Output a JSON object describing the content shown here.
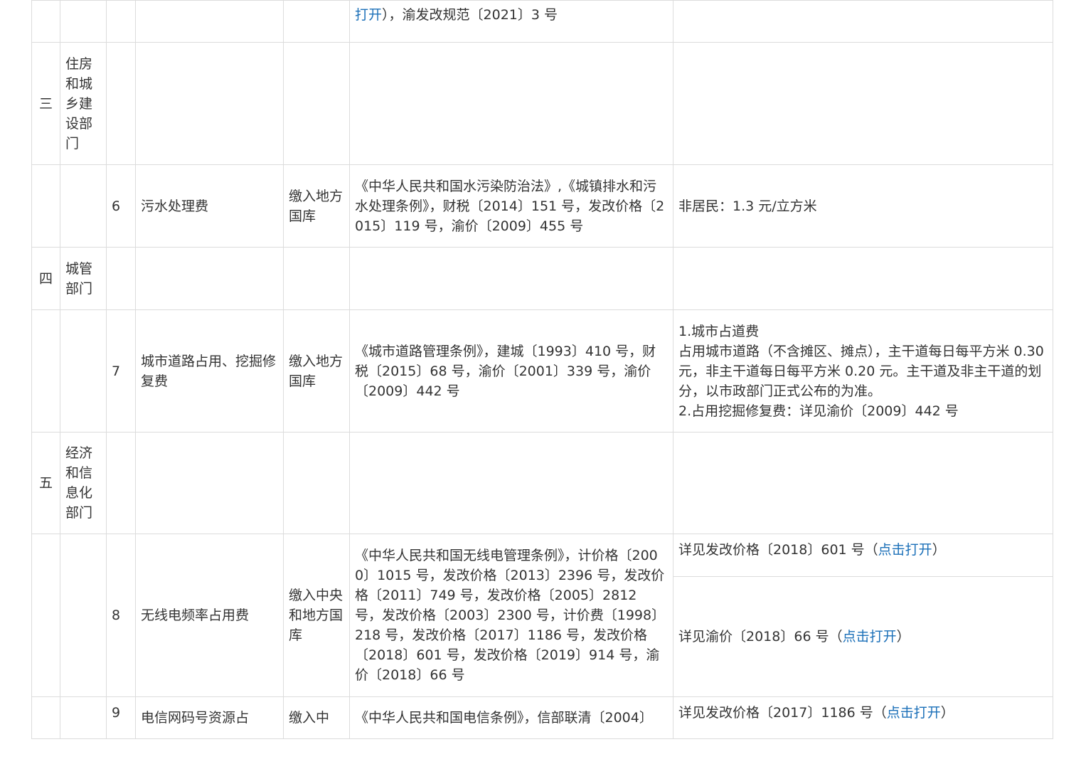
{
  "rows": {
    "row_top": {
      "basis_link": "打开",
      "basis_rest": "），渝发改规范〔2021〕3 号"
    },
    "section_3": {
      "index": "三",
      "dept": "住房和城乡建设部门"
    },
    "item_6": {
      "no": "6",
      "name": "污水处理费",
      "treasury": "缴入地方国库",
      "basis": "《中华人民共和国水污染防治法》,《城镇排水和污水处理条例》，财税〔2014〕151 号，发改价格〔2015〕119 号，渝价〔2009〕455 号",
      "standard": "非居民：1.3 元/立方米"
    },
    "section_4": {
      "index": "四",
      "dept": "城管部门"
    },
    "item_7": {
      "no": "7",
      "name": "城市道路占用、挖掘修复费",
      "treasury": "缴入地方国库",
      "basis": "《城市道路管理条例》，建城〔1993〕410 号，财税〔2015〕68 号，渝价〔2001〕339 号，渝价〔2009〕442 号",
      "standard_line1": "1.城市占道费",
      "standard_line2": "占用城市道路（不含摊区、摊点），主干道每日每平方米 0.30 元，非主干道每日每平方米 0.20 元。主干道及非主干道的划分，以市政部门正式公布的为准。",
      "standard_line3": "2.占用挖掘修复费：详见渝价〔2009〕442 号"
    },
    "section_5": {
      "index": "五",
      "dept": "经济和信息化部门"
    },
    "item_8": {
      "no": "8",
      "name": "无线电频率占用费",
      "treasury": "缴入中央和地方国库",
      "basis": "《中华人民共和国无线电管理条例》，计价格〔2000〕1015 号，发改价格〔2013〕2396 号，发改价格〔2011〕749 号，发改价格〔2005〕2812 号，发改价格〔2003〕2300 号，计价费〔1998〕218 号，发改价格〔2017〕1186 号，发改价格〔2018〕601 号，发改价格〔2019〕914 号，渝价〔2018〕66 号",
      "standard_a_text": "详见发改价格〔2018〕601 号（",
      "standard_a_link": "点击打开",
      "standard_a_end": "）",
      "standard_b_text": "详见渝价〔2018〕66 号（",
      "standard_b_link": "点击打开",
      "standard_b_end": "）"
    },
    "item_9": {
      "no": "9",
      "name": "电信网码号资源占",
      "treasury": "缴入中",
      "basis": "《中华人民共和国电信条例》，信部联清〔2004〕",
      "standard_text": "详见发改价格〔2017〕1186 号（",
      "standard_link": "点击打开",
      "standard_end": "）"
    }
  }
}
